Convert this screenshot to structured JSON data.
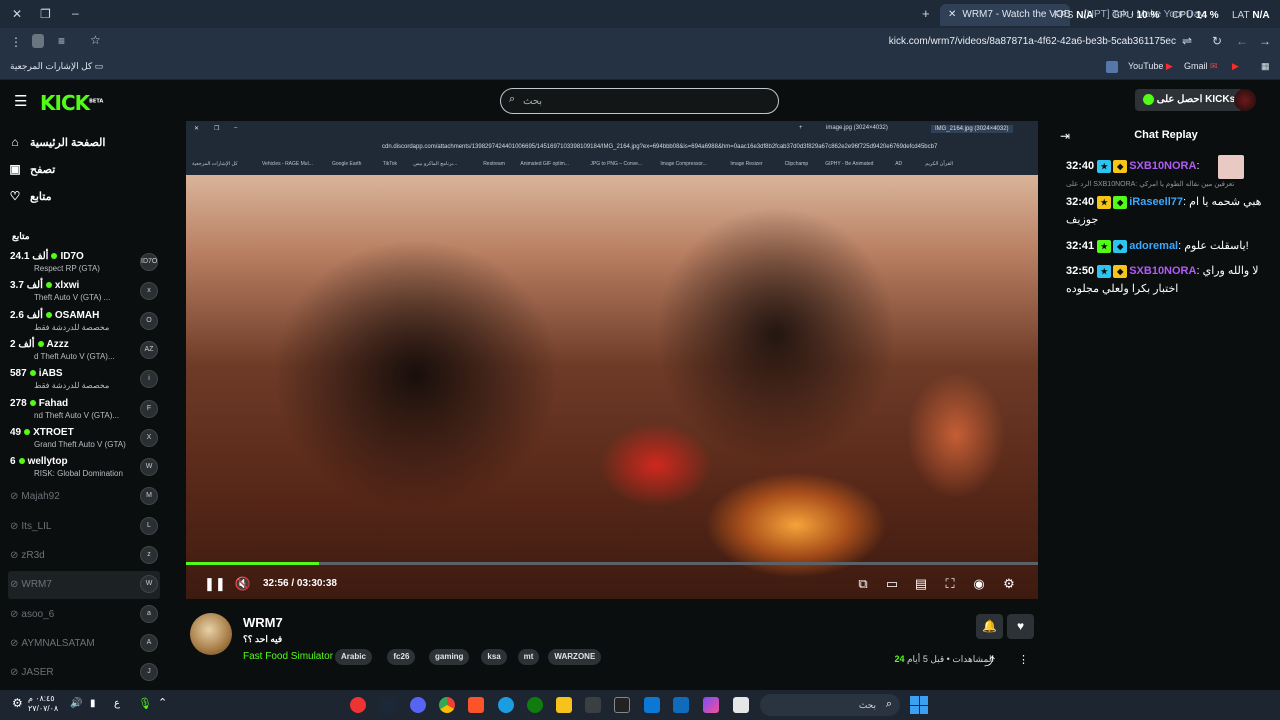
{
  "browser": {
    "tabs": [
      {
        "label": "WRM7 - Watch the VOD on Kic",
        "active": true
      },
      {
        "label": "[UPT] Tok - Make Your Day",
        "active": false
      }
    ],
    "new_tab": "+",
    "stats": {
      "fps_label": "FPS",
      "fps": "N/A",
      "gpu_label": "GPU",
      "gpu": "10 %",
      "cpu_label": "CPU",
      "cpu": "14 %",
      "lat_label": "LAT",
      "lat": "N/A"
    },
    "url": "kick.com/wrm7/videos/8a87871a-4f62-42a6-be3b-5cab361175ec",
    "bookmarks": {
      "all_label": "كل الإشارات المرجعية",
      "youtube": "YouTube",
      "gmail": "Gmail"
    }
  },
  "header": {
    "logo": "KICK",
    "logo_beta": "BETA",
    "search_placeholder": "بحث",
    "get_kicks": "احصل على KICKs"
  },
  "sidebar": {
    "nav": [
      {
        "label": "الصفحة الرئيسية",
        "icon": "home-icon"
      },
      {
        "label": "تصفح",
        "icon": "browse-icon"
      },
      {
        "label": "متابع",
        "icon": "heart-icon"
      }
    ],
    "section_title": "متابع",
    "channels": [
      {
        "name": "ID7O",
        "viewers": "24.1 ألف",
        "category": "Respect RP (GTA)",
        "live": true,
        "avatar": "ID7O"
      },
      {
        "name": "xlxwi",
        "viewers": "3.7 ألف",
        "category": "Theft Auto V (GTA) ...",
        "live": true,
        "avatar": "x"
      },
      {
        "name": "OSAMAH",
        "viewers": "2.6 ألف",
        "category": "مخصصة للدردشة فقط",
        "live": true,
        "avatar": "O"
      },
      {
        "name": "Azzz",
        "viewers": "2 ألف",
        "category": "d Theft Auto V (GTA)...",
        "live": true,
        "avatar": "AZ"
      },
      {
        "name": "iABS",
        "viewers": "587",
        "category": "مخصصة للدردشة فقط",
        "live": true,
        "avatar": "i"
      },
      {
        "name": "Fahad",
        "viewers": "278",
        "category": "nd Theft Auto V (GTA)...",
        "live": true,
        "avatar": "F"
      },
      {
        "name": "XTROET",
        "viewers": "49",
        "category": "Grand Theft Auto V (GTA)",
        "live": true,
        "avatar": "X"
      },
      {
        "name": "wellytop",
        "viewers": "6",
        "category": "RISK: Global Domination",
        "live": true,
        "avatar": "W"
      },
      {
        "name": "Majah92",
        "viewers": "",
        "category": "",
        "live": false,
        "avatar": "M"
      },
      {
        "name": "Its_LIL",
        "viewers": "",
        "category": "",
        "live": false,
        "avatar": "L"
      },
      {
        "name": "zR3d",
        "viewers": "",
        "category": "",
        "live": false,
        "avatar": "z"
      },
      {
        "name": "WRM7",
        "viewers": "",
        "category": "",
        "live": false,
        "avatar": "W",
        "active": true
      },
      {
        "name": "asoo_6",
        "viewers": "",
        "category": "",
        "live": false,
        "avatar": "a"
      },
      {
        "name": "AYMNALSATAM",
        "viewers": "",
        "category": "",
        "live": false,
        "avatar": "A"
      },
      {
        "name": "JASER",
        "viewers": "",
        "category": "",
        "live": false,
        "avatar": "J"
      }
    ]
  },
  "video": {
    "inner_url": "cdn.discordapp.com/attachments/1398297424401006695/1451697103398109184/IMG_2164.jpg?ex=694bbb08&is=694a6988&hm=0aac16e3df8b2fcab37d0d3f829a67c862e2e96f725d9420e6769defcd45bcb7",
    "inner_tabs": [
      "image.jpg (3024×4032)",
      "IMG_2164.jpg (3024×4032)"
    ],
    "inner_bookmarks": [
      "كل الإشارات المرجعية",
      "Vehicles - RAGE Mul...",
      "Google Earth",
      "TikTok",
      "برنامج الماكرو بيس...",
      "Restream",
      "Animated GIF optim...",
      "JPG to PNG – Conve...",
      "Image Compressor...",
      "Image Resizer",
      "Clipchamp",
      "GIPHY - Be Animated",
      "AD",
      "القرآن الكريم"
    ],
    "time": "32:56 / 03:30:38",
    "progress": 0.156
  },
  "channel": {
    "name": "WRM7",
    "title": "فيه احد ؟؟",
    "category": "Fast Food Simulator",
    "tags": [
      "Arabic",
      "fc26",
      "gaming",
      "ksa",
      "mt",
      "WARZONE"
    ],
    "views_label": "المشاهدات",
    "views": "24",
    "age": "قبل 5 أيام"
  },
  "chat": {
    "title": "Chat Replay",
    "messages": [
      {
        "time": "32:40",
        "user": "SXB10NORA",
        "color": "#b05cf5",
        "text": ""
      },
      {
        "time": "32:40",
        "user": "iRaseell77",
        "color": "#3ba8ff",
        "text": "هبي شحمه يا ام جوزيف",
        "reply": "الرد على SXB10NORA: تعرفين مين نفاله الطوم يا امركي"
      },
      {
        "time": "32:41",
        "user": "adoremal",
        "color": "#3ba8ff",
        "text": "ياسقلت علوم!"
      },
      {
        "time": "32:50",
        "user": "SXB10NORA",
        "color": "#b05cf5",
        "text": "لا والله وراي اختبار بكرا ولعلي مجلوده"
      }
    ]
  },
  "taskbar": {
    "clock_time": "٠٨:٤٥ م",
    "clock_date": "٢٧/٠٧/٠٨",
    "search_placeholder": "بحث",
    "lang": "ع"
  }
}
